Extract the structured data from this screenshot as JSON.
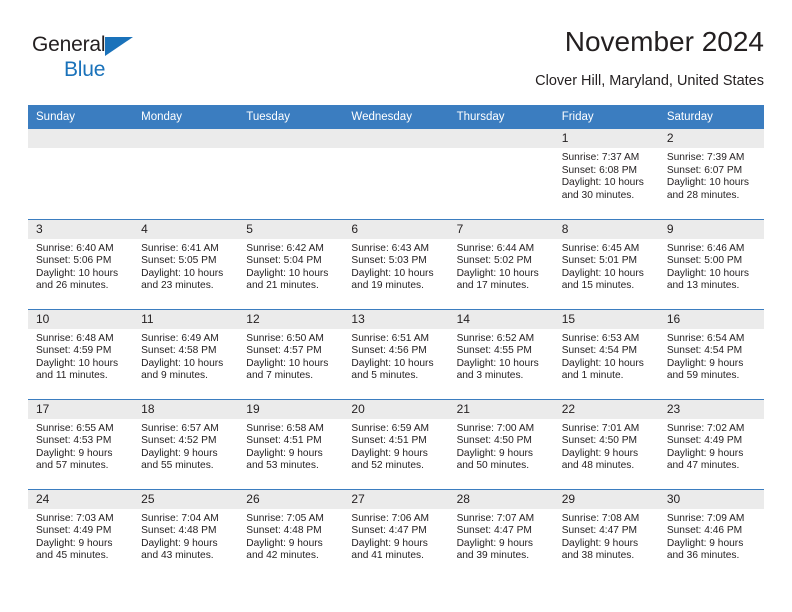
{
  "brand": {
    "line1": "General",
    "line2": "Blue",
    "triangle_color": "#1a72ba",
    "text_color": "#231f20"
  },
  "header": {
    "title": "November 2024",
    "subtitle": "Clover Hill, Maryland, United States"
  },
  "theme": {
    "header_blue": "#3b7dc0",
    "daynum_gray": "#ebebeb",
    "text": "#231f20",
    "cell_white": "#ffffff"
  },
  "calendar": {
    "weekday_headers": [
      "Sunday",
      "Monday",
      "Tuesday",
      "Wednesday",
      "Thursday",
      "Friday",
      "Saturday"
    ],
    "labels": {
      "sunrise": "Sunrise:",
      "sunset": "Sunset:",
      "daylight": "Daylight:"
    },
    "weeks": [
      [
        {
          "day": "",
          "empty": true
        },
        {
          "day": "",
          "empty": true
        },
        {
          "day": "",
          "empty": true
        },
        {
          "day": "",
          "empty": true
        },
        {
          "day": "",
          "empty": true
        },
        {
          "day": "1",
          "sunrise": "Sunrise: 7:37 AM",
          "sunset": "Sunset: 6:08 PM",
          "daylight": "Daylight: 10 hours and 30 minutes."
        },
        {
          "day": "2",
          "sunrise": "Sunrise: 7:39 AM",
          "sunset": "Sunset: 6:07 PM",
          "daylight": "Daylight: 10 hours and 28 minutes."
        }
      ],
      [
        {
          "day": "3",
          "sunrise": "Sunrise: 6:40 AM",
          "sunset": "Sunset: 5:06 PM",
          "daylight": "Daylight: 10 hours and 26 minutes."
        },
        {
          "day": "4",
          "sunrise": "Sunrise: 6:41 AM",
          "sunset": "Sunset: 5:05 PM",
          "daylight": "Daylight: 10 hours and 23 minutes."
        },
        {
          "day": "5",
          "sunrise": "Sunrise: 6:42 AM",
          "sunset": "Sunset: 5:04 PM",
          "daylight": "Daylight: 10 hours and 21 minutes."
        },
        {
          "day": "6",
          "sunrise": "Sunrise: 6:43 AM",
          "sunset": "Sunset: 5:03 PM",
          "daylight": "Daylight: 10 hours and 19 minutes."
        },
        {
          "day": "7",
          "sunrise": "Sunrise: 6:44 AM",
          "sunset": "Sunset: 5:02 PM",
          "daylight": "Daylight: 10 hours and 17 minutes."
        },
        {
          "day": "8",
          "sunrise": "Sunrise: 6:45 AM",
          "sunset": "Sunset: 5:01 PM",
          "daylight": "Daylight: 10 hours and 15 minutes."
        },
        {
          "day": "9",
          "sunrise": "Sunrise: 6:46 AM",
          "sunset": "Sunset: 5:00 PM",
          "daylight": "Daylight: 10 hours and 13 minutes."
        }
      ],
      [
        {
          "day": "10",
          "sunrise": "Sunrise: 6:48 AM",
          "sunset": "Sunset: 4:59 PM",
          "daylight": "Daylight: 10 hours and 11 minutes."
        },
        {
          "day": "11",
          "sunrise": "Sunrise: 6:49 AM",
          "sunset": "Sunset: 4:58 PM",
          "daylight": "Daylight: 10 hours and 9 minutes."
        },
        {
          "day": "12",
          "sunrise": "Sunrise: 6:50 AM",
          "sunset": "Sunset: 4:57 PM",
          "daylight": "Daylight: 10 hours and 7 minutes."
        },
        {
          "day": "13",
          "sunrise": "Sunrise: 6:51 AM",
          "sunset": "Sunset: 4:56 PM",
          "daylight": "Daylight: 10 hours and 5 minutes."
        },
        {
          "day": "14",
          "sunrise": "Sunrise: 6:52 AM",
          "sunset": "Sunset: 4:55 PM",
          "daylight": "Daylight: 10 hours and 3 minutes."
        },
        {
          "day": "15",
          "sunrise": "Sunrise: 6:53 AM",
          "sunset": "Sunset: 4:54 PM",
          "daylight": "Daylight: 10 hours and 1 minute."
        },
        {
          "day": "16",
          "sunrise": "Sunrise: 6:54 AM",
          "sunset": "Sunset: 4:54 PM",
          "daylight": "Daylight: 9 hours and 59 minutes."
        }
      ],
      [
        {
          "day": "17",
          "sunrise": "Sunrise: 6:55 AM",
          "sunset": "Sunset: 4:53 PM",
          "daylight": "Daylight: 9 hours and 57 minutes."
        },
        {
          "day": "18",
          "sunrise": "Sunrise: 6:57 AM",
          "sunset": "Sunset: 4:52 PM",
          "daylight": "Daylight: 9 hours and 55 minutes."
        },
        {
          "day": "19",
          "sunrise": "Sunrise: 6:58 AM",
          "sunset": "Sunset: 4:51 PM",
          "daylight": "Daylight: 9 hours and 53 minutes."
        },
        {
          "day": "20",
          "sunrise": "Sunrise: 6:59 AM",
          "sunset": "Sunset: 4:51 PM",
          "daylight": "Daylight: 9 hours and 52 minutes."
        },
        {
          "day": "21",
          "sunrise": "Sunrise: 7:00 AM",
          "sunset": "Sunset: 4:50 PM",
          "daylight": "Daylight: 9 hours and 50 minutes."
        },
        {
          "day": "22",
          "sunrise": "Sunrise: 7:01 AM",
          "sunset": "Sunset: 4:50 PM",
          "daylight": "Daylight: 9 hours and 48 minutes."
        },
        {
          "day": "23",
          "sunrise": "Sunrise: 7:02 AM",
          "sunset": "Sunset: 4:49 PM",
          "daylight": "Daylight: 9 hours and 47 minutes."
        }
      ],
      [
        {
          "day": "24",
          "sunrise": "Sunrise: 7:03 AM",
          "sunset": "Sunset: 4:49 PM",
          "daylight": "Daylight: 9 hours and 45 minutes."
        },
        {
          "day": "25",
          "sunrise": "Sunrise: 7:04 AM",
          "sunset": "Sunset: 4:48 PM",
          "daylight": "Daylight: 9 hours and 43 minutes."
        },
        {
          "day": "26",
          "sunrise": "Sunrise: 7:05 AM",
          "sunset": "Sunset: 4:48 PM",
          "daylight": "Daylight: 9 hours and 42 minutes."
        },
        {
          "day": "27",
          "sunrise": "Sunrise: 7:06 AM",
          "sunset": "Sunset: 4:47 PM",
          "daylight": "Daylight: 9 hours and 41 minutes."
        },
        {
          "day": "28",
          "sunrise": "Sunrise: 7:07 AM",
          "sunset": "Sunset: 4:47 PM",
          "daylight": "Daylight: 9 hours and 39 minutes."
        },
        {
          "day": "29",
          "sunrise": "Sunrise: 7:08 AM",
          "sunset": "Sunset: 4:47 PM",
          "daylight": "Daylight: 9 hours and 38 minutes."
        },
        {
          "day": "30",
          "sunrise": "Sunrise: 7:09 AM",
          "sunset": "Sunset: 4:46 PM",
          "daylight": "Daylight: 9 hours and 36 minutes."
        }
      ]
    ]
  }
}
